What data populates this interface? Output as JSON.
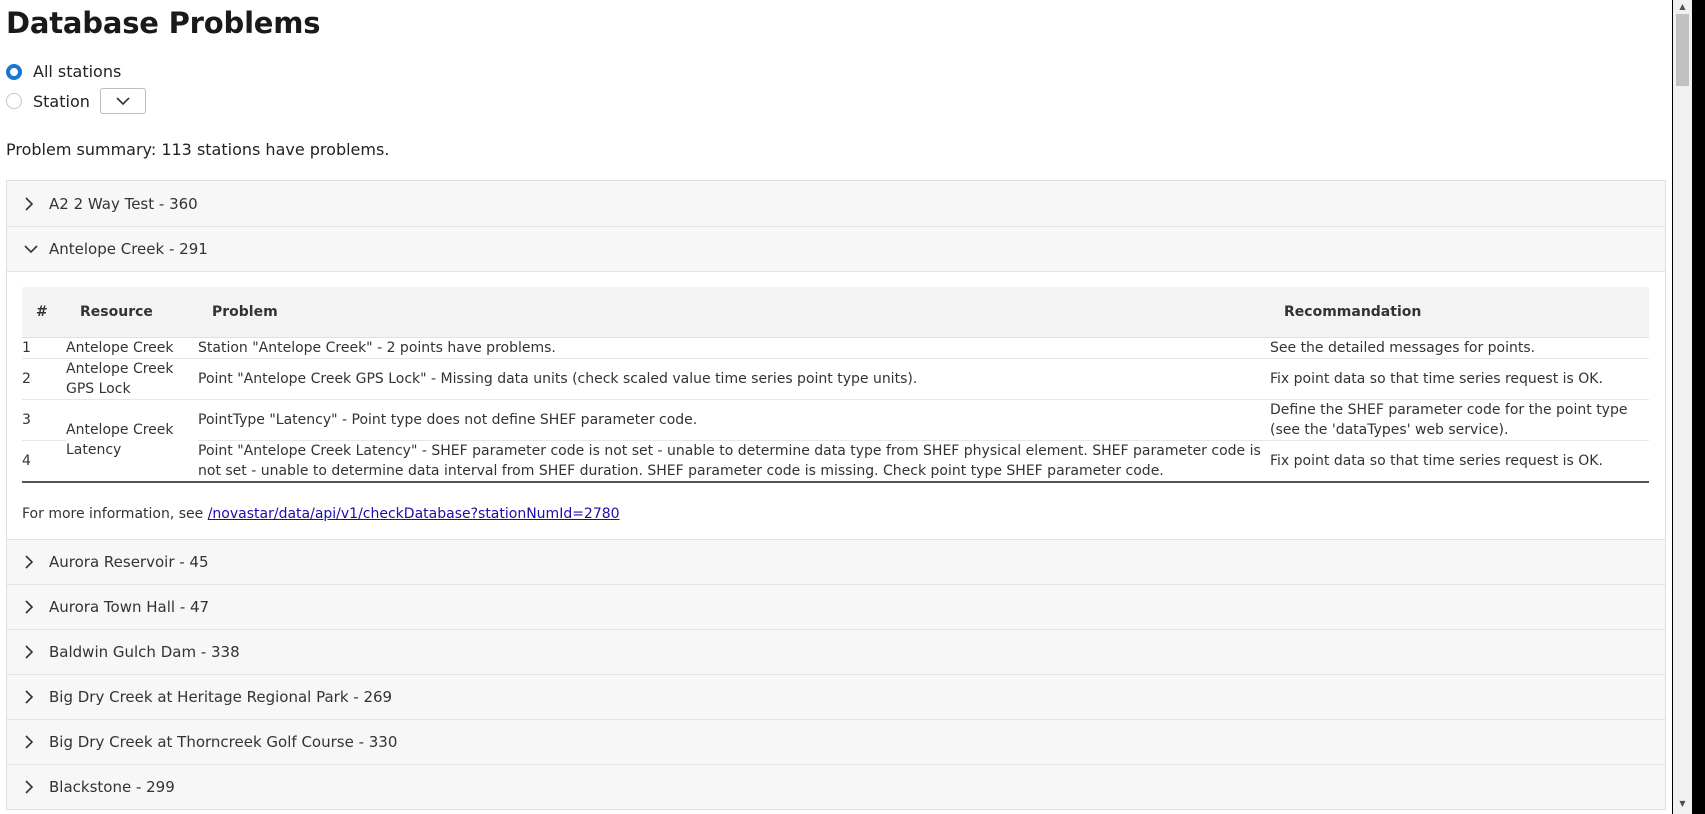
{
  "page": {
    "title": "Database Problems"
  },
  "filter": {
    "all_label": "All stations",
    "station_label": "Station",
    "station_select_value": ""
  },
  "summary": "Problem summary: 113 stations have problems.",
  "stations": [
    {
      "label": "A2 2 Way Test - 360",
      "expanded": false
    },
    {
      "label": "Antelope Creek - 291",
      "expanded": true
    },
    {
      "label": "Aurora Reservoir - 45",
      "expanded": false
    },
    {
      "label": "Aurora Town Hall - 47",
      "expanded": false
    },
    {
      "label": "Baldwin Gulch Dam - 338",
      "expanded": false
    },
    {
      "label": "Big Dry Creek at Heritage Regional Park - 269",
      "expanded": false
    },
    {
      "label": "Big Dry Creek at Thorncreek Golf Course - 330",
      "expanded": false
    },
    {
      "label": "Blackstone - 299",
      "expanded": false
    }
  ],
  "problems_table": {
    "headers": {
      "num": "#",
      "resource": "Resource",
      "problem": "Problem",
      "recommendation": "Recommandation"
    },
    "rows": [
      {
        "num": "1",
        "resource": "Antelope Creek",
        "problem": "Station \"Antelope Creek\" - 2 points have problems.",
        "recommendation": "See the detailed messages for points."
      },
      {
        "num": "2",
        "resource": "Antelope Creek GPS Lock",
        "problem": "Point \"Antelope Creek GPS Lock\" - Missing data units (check scaled value time series point type units).",
        "recommendation": "Fix point data so that time series request is OK."
      },
      {
        "num": "3",
        "resource": "Antelope Creek Latency",
        "problem": "PointType \"Latency\" - Point type does not define SHEF parameter code.",
        "recommendation": "Define the SHEF parameter code for the point type (see the 'dataTypes' web service)."
      },
      {
        "num": "4",
        "resource": "",
        "problem": "Point \"Antelope Creek Latency\" - SHEF parameter code is not set - unable to determine data type from SHEF physical element. SHEF parameter code is not set - unable to determine data interval from SHEF duration. SHEF parameter code is missing. Check point type SHEF parameter code.",
        "recommendation": "Fix point data so that time series request is OK."
      }
    ]
  },
  "more_info": {
    "text": "For more information, see ",
    "link_text": "/novastar/data/api/v1/checkDatabase?stationNumId=2780"
  },
  "icons": {
    "collapsed": "chevron-right-icon",
    "expanded": "chevron-down-icon",
    "select": "chevron-down-icon"
  },
  "colors": {
    "radio_accent": "#1976d2",
    "link": "#1a0dab",
    "header_bg": "#f7f7f8"
  }
}
